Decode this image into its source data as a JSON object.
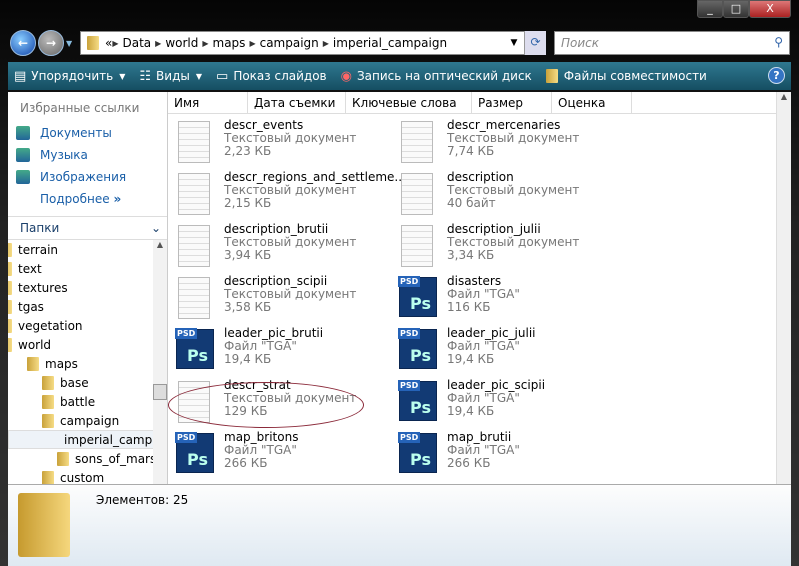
{
  "window": {
    "minimize": "_",
    "maximize": "□",
    "close": "X"
  },
  "address": {
    "overflow": "«",
    "crumbs": [
      "Data",
      "world",
      "maps",
      "campaign",
      "imperial_campaign"
    ]
  },
  "search": {
    "placeholder": "Поиск"
  },
  "toolbar": {
    "organize": "Упорядочить",
    "views": "Виды",
    "slideshow": "Показ слайдов",
    "burn": "Запись на оптический диск",
    "compat": "Файлы совместимости",
    "help": "?"
  },
  "sidebar": {
    "favorites_header": "Избранные ссылки",
    "links": [
      "Документы",
      "Музыка",
      "Изображения"
    ],
    "more": "Подробнее",
    "folders_header": "Папки",
    "tree": [
      {
        "name": "terrain",
        "level": 0
      },
      {
        "name": "text",
        "level": 0
      },
      {
        "name": "textures",
        "level": 0
      },
      {
        "name": "tgas",
        "level": 0
      },
      {
        "name": "vegetation",
        "level": 0
      },
      {
        "name": "world",
        "level": 0
      },
      {
        "name": "maps",
        "level": 1
      },
      {
        "name": "base",
        "level": 2
      },
      {
        "name": "battle",
        "level": 2
      },
      {
        "name": "campaign",
        "level": 2
      },
      {
        "name": "imperial_campaign",
        "level": 3,
        "selected": true
      },
      {
        "name": "sons_of_mars",
        "level": 3
      },
      {
        "name": "custom",
        "level": 2
      }
    ]
  },
  "columns": [
    "Имя",
    "Дата съемки",
    "Ключевые слова",
    "Размер",
    "Оценка"
  ],
  "files": [
    {
      "name": "descr_events",
      "type": "Текстовый документ",
      "size": "2,23 КБ",
      "icon": "txt"
    },
    {
      "name": "descr_mercenaries",
      "type": "Текстовый документ",
      "size": "7,74 КБ",
      "icon": "txt"
    },
    {
      "name": "descr_regions_and_settleme...",
      "type": "Текстовый документ",
      "size": "2,15 КБ",
      "icon": "txt"
    },
    {
      "name": "description",
      "type": "Текстовый документ",
      "size": "40 байт",
      "icon": "txt"
    },
    {
      "name": "description_brutii",
      "type": "Текстовый документ",
      "size": "3,94 КБ",
      "icon": "txt"
    },
    {
      "name": "description_julii",
      "type": "Текстовый документ",
      "size": "3,34 КБ",
      "icon": "txt"
    },
    {
      "name": "description_scipii",
      "type": "Текстовый документ",
      "size": "3,58 КБ",
      "icon": "txt"
    },
    {
      "name": "disasters",
      "type": "Файл \"TGA\"",
      "size": "116 КБ",
      "icon": "psd"
    },
    {
      "name": "leader_pic_brutii",
      "type": "Файл \"TGA\"",
      "size": "19,4 КБ",
      "icon": "psd"
    },
    {
      "name": "leader_pic_julii",
      "type": "Файл \"TGA\"",
      "size": "19,4 КБ",
      "icon": "psd"
    },
    {
      "name": "descr_strat",
      "type": "Текстовый документ",
      "size": "129 КБ",
      "icon": "txt"
    },
    {
      "name": "leader_pic_scipii",
      "type": "Файл \"TGA\"",
      "size": "19,4 КБ",
      "icon": "psd"
    },
    {
      "name": "map_britons",
      "type": "Файл \"TGA\"",
      "size": "266 КБ",
      "icon": "psd"
    },
    {
      "name": "map_brutii",
      "type": "Файл \"TGA\"",
      "size": "266 КБ",
      "icon": "psd"
    }
  ],
  "status": {
    "count": "Элементов: 25"
  }
}
